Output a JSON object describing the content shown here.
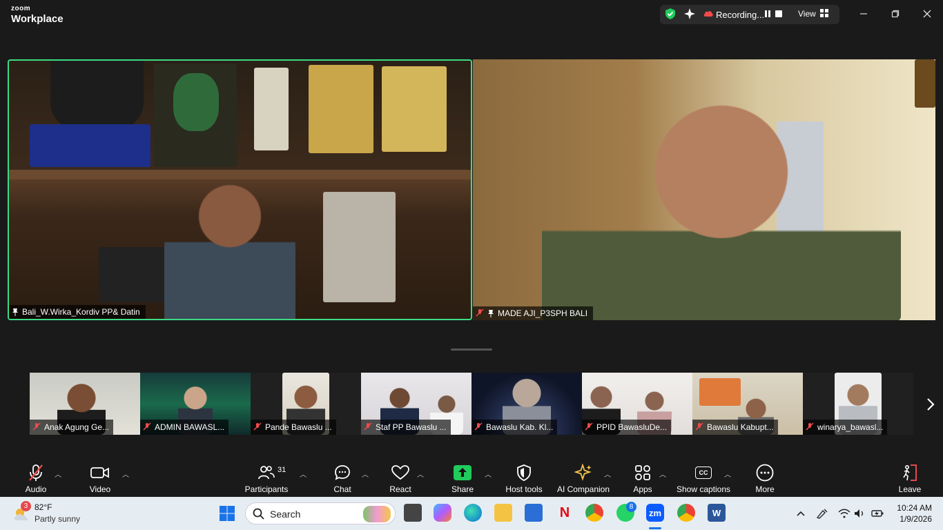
{
  "app": {
    "brand_top": "zoom",
    "brand_bottom": "Workplace",
    "recording_label": "Recording...",
    "view_label": "View"
  },
  "tiles": {
    "left": {
      "name": "Bali_W.Wirka_Kordiv PP& Datin"
    },
    "right": {
      "name": "MADE AJI_P3SPH BALI"
    }
  },
  "thumbnails": [
    {
      "name": "Anak Agung Ge..."
    },
    {
      "name": "ADMIN BAWASL..."
    },
    {
      "name": "Pande Bawaslu ..."
    },
    {
      "name": "Staf PP Bawaslu ..."
    },
    {
      "name": "Bawaslu Kab. Kl..."
    },
    {
      "name": "PPID BawasluDe..."
    },
    {
      "name": "Bawaslu Kabupt..."
    },
    {
      "name": "winarya_bawasl..."
    }
  ],
  "toolbar": {
    "audio": "Audio",
    "video": "Video",
    "participants": "Participants",
    "participants_count": "31",
    "chat": "Chat",
    "react": "React",
    "share": "Share",
    "host_tools": "Host tools",
    "ai_companion": "AI Companion",
    "apps": "Apps",
    "captions": "Show captions",
    "captions_icon_text": "CC",
    "more": "More",
    "leave": "Leave"
  },
  "taskbar": {
    "weather_temp": "82°F",
    "weather_condition": "Partly sunny",
    "weather_badge": "3",
    "search_placeholder": "Search",
    "zoom_icon_text": "zm",
    "whatsapp_badge": "8",
    "time": "10:24 AM",
    "date": "1/9/2026"
  },
  "colors": {
    "active_speaker_border": "#3ddc84",
    "mic_muted": "#f24a4a",
    "share_green": "#1fcc5c",
    "leave_red": "#e5484d"
  }
}
